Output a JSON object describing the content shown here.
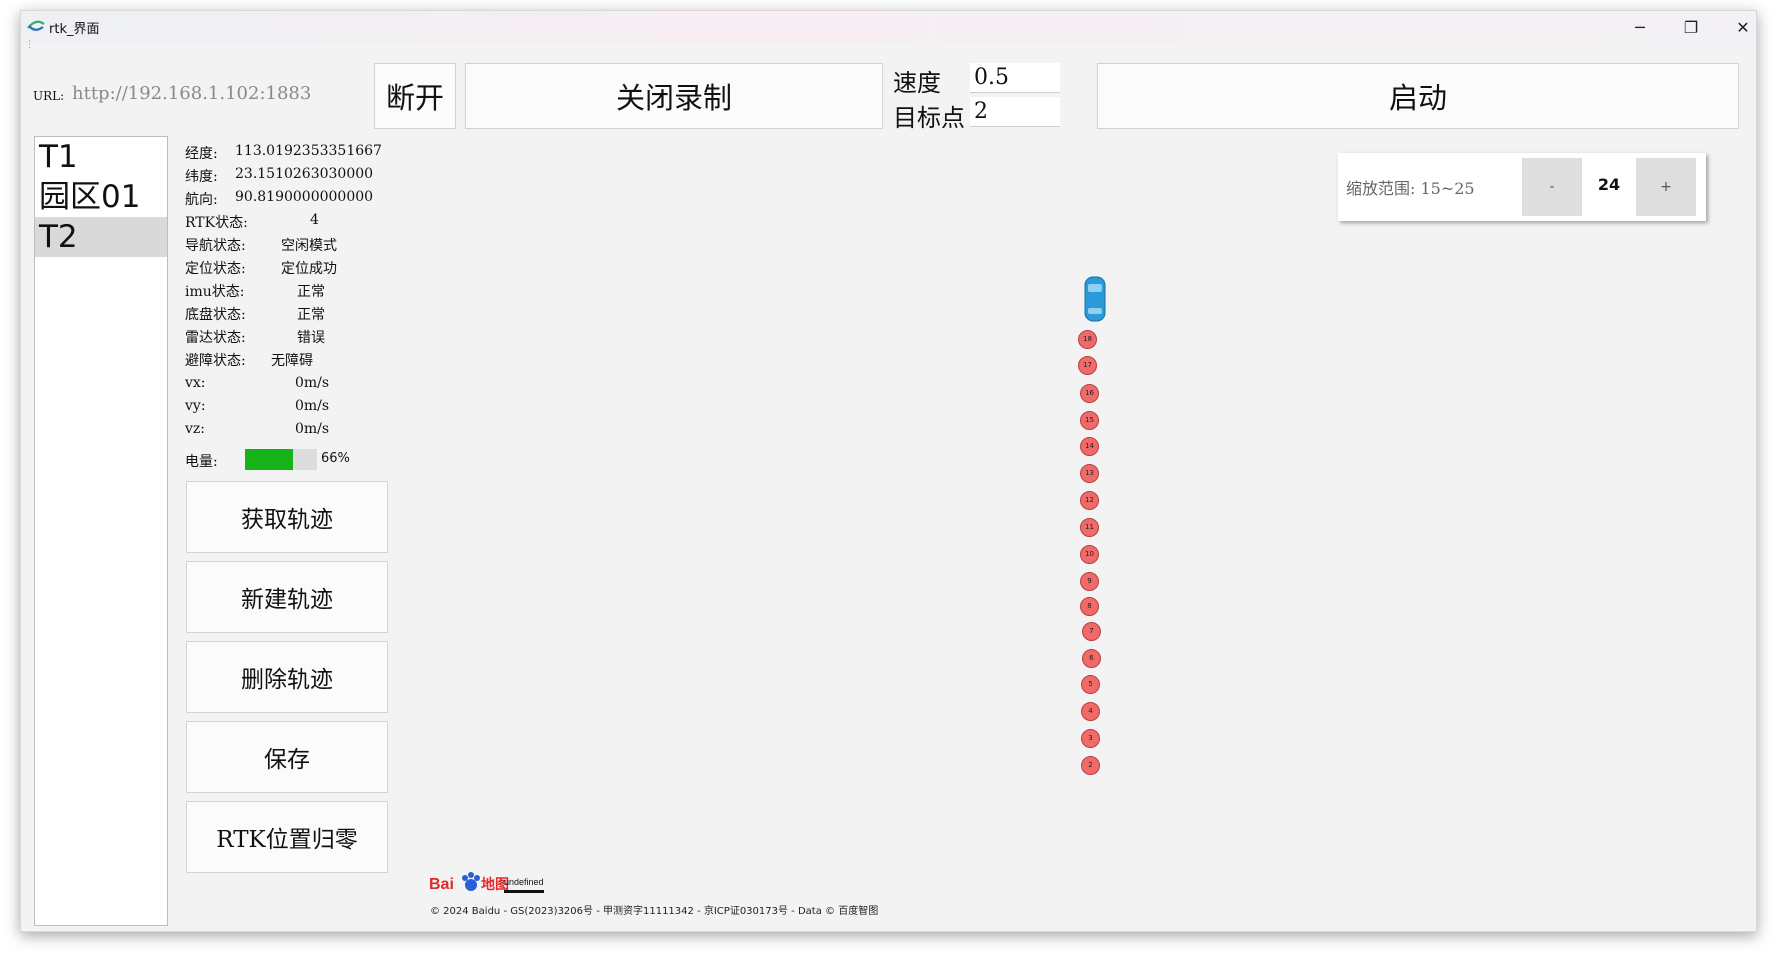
{
  "window": {
    "title": "rtk_界面"
  },
  "toolbar": {
    "url_label": "URL:",
    "url_value": "http://192.168.1.102:1883",
    "disconnect_label": "断开",
    "record_label": "关闭录制",
    "speed_label": "速度",
    "speed_value": "0.5",
    "target_label": "目标点",
    "target_value": "2",
    "start_label": "启动"
  },
  "tracks": [
    "T1",
    "园区01",
    "T2"
  ],
  "selected_track": "T2",
  "status": {
    "longitude_label": "经度:",
    "longitude_value": "113.0192353351667",
    "latitude_label": "纬度:",
    "latitude_value": "23.1510263030000",
    "heading_label": "航向:",
    "heading_value": "90.8190000000000",
    "rtk_label": "RTK状态:",
    "rtk_value": "4",
    "nav_label": "导航状态:",
    "nav_value": "空闲模式",
    "loc_label": "定位状态:",
    "loc_value": "定位成功",
    "imu_label": "imu状态:",
    "imu_value": "正常",
    "chassis_label": "底盘状态:",
    "chassis_value": "正常",
    "radar_label": "雷达状态:",
    "radar_value": "错误",
    "avoid_label": "避障状态:",
    "avoid_value": "无障碍",
    "vx_label": "vx:",
    "vx_value": "0m/s",
    "vy_label": "vy:",
    "vy_value": "0m/s",
    "vz_label": "vz:",
    "vz_value": "0m/s",
    "battery_label": "电量:",
    "battery_text": "66%",
    "battery_percent": 66,
    "battery_color": "#16b21a"
  },
  "actions": {
    "get_track": "获取轨迹",
    "new_track": "新建轨迹",
    "delete_track": "删除轨迹",
    "save": "保存",
    "rtk_reset": "RTK位置归零"
  },
  "map": {
    "zoom_label": "缩放范围: 15~25",
    "zoom_minus": "-",
    "zoom_value": "24",
    "zoom_plus": "+",
    "waypoints": [
      "18",
      "17",
      "16",
      "15",
      "14",
      "13",
      "12",
      "11",
      "10",
      "9",
      "8",
      "7",
      "6",
      "5",
      "4",
      "3",
      "2"
    ],
    "marker_color": "#f06a6a",
    "vehicle_icon": "car-icon",
    "scale_text": "undefined",
    "copyright": "© 2024 Baidu - GS(2023)3206号 - 甲测资字11111342 - 京ICP证030173号 - Data © 百度智图"
  },
  "window_controls": {
    "minimize": "─",
    "maximize": "❐",
    "close": "✕"
  }
}
